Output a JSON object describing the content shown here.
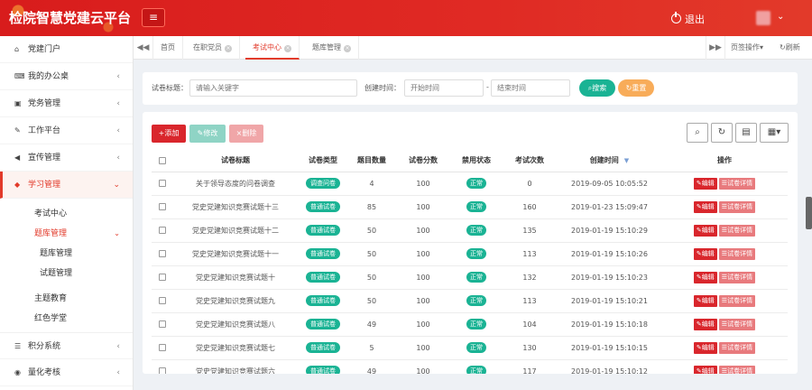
{
  "app": {
    "title": "检院智慧党建云平台",
    "menu_icon": "bars-icon",
    "logout": "退出"
  },
  "sidebar": {
    "items": [
      {
        "label": "党建门户",
        "icon": "home-icon",
        "arrow": ""
      },
      {
        "label": "我的办公桌",
        "icon": "keyboard-icon",
        "arrow": "‹"
      },
      {
        "label": "党务管理",
        "icon": "id-card-icon",
        "arrow": "‹"
      },
      {
        "label": "工作平台",
        "icon": "edit-icon",
        "arrow": "‹"
      },
      {
        "label": "宣传管理",
        "icon": "bullhorn-icon",
        "arrow": "‹"
      },
      {
        "label": "学习管理",
        "icon": "graduation-cap-icon",
        "arrow": "⌄"
      }
    ],
    "sub": {
      "exam_center": "考试中心",
      "question_bank_mgmt": "题库管理",
      "question_bank_mgmt_arrow": "⌄",
      "question_bank": "题库管理",
      "question_mgmt": "试题管理",
      "theme_edu": "主题教育",
      "red_study": "红色学堂"
    },
    "bottom": [
      {
        "label": "积分系统",
        "icon": "list-icon",
        "arrow": "‹"
      },
      {
        "label": "量化考核",
        "icon": "database-icon",
        "arrow": "‹"
      }
    ]
  },
  "tabs": {
    "prev": "◀◀",
    "items": [
      {
        "label": "首页"
      },
      {
        "label": "在职党员",
        "close": "×"
      },
      {
        "label": "考试中心",
        "close": "×"
      },
      {
        "label": "题库管理",
        "close": "×"
      }
    ],
    "next": "▶▶",
    "page_ops": "页签操作",
    "page_ops_caret": "▾",
    "refresh": "刷新"
  },
  "search": {
    "title_label": "试卷标题：",
    "title_placeholder": "请输入关键字",
    "time_label": "创建时间：",
    "start_placeholder": "开始时间",
    "sep": "-",
    "end_placeholder": "结束时间",
    "search_btn": "搜索",
    "reset_btn": "重置"
  },
  "toolbar": {
    "add": "添加",
    "edit": "修改",
    "delete": "删除"
  },
  "tools": {
    "search_icon": "search-icon",
    "refresh_icon": "refresh-icon",
    "export_icon": "export-icon",
    "columns_icon": "grid-icon",
    "columns_caret": "▾"
  },
  "table": {
    "headers": [
      "试卷标题",
      "试卷类型",
      "题目数量",
      "试卷分数",
      "禁用状态",
      "考试次数",
      "创建时间",
      "操作"
    ],
    "sort_icon": "▼",
    "edit_label": "编辑",
    "detail_label": "试卷详情",
    "rows": [
      {
        "title": "关于领导态度的问卷调查",
        "type": "调查问卷",
        "count": "4",
        "score": "100",
        "status": "正常",
        "times": "0",
        "created": "2019-09-05 10:05:52"
      },
      {
        "title": "党史党建知识竞赛试题十三",
        "type": "普通试卷",
        "count": "85",
        "score": "100",
        "status": "正常",
        "times": "160",
        "created": "2019-01-23 15:09:47"
      },
      {
        "title": "党史党建知识竞赛试题十二",
        "type": "普通试卷",
        "count": "50",
        "score": "100",
        "status": "正常",
        "times": "135",
        "created": "2019-01-19 15:10:29"
      },
      {
        "title": "党史党建知识竞赛试题十一",
        "type": "普通试卷",
        "count": "50",
        "score": "100",
        "status": "正常",
        "times": "113",
        "created": "2019-01-19 15:10:26"
      },
      {
        "title": "党史党建知识竞赛试题十",
        "type": "普通试卷",
        "count": "50",
        "score": "100",
        "status": "正常",
        "times": "132",
        "created": "2019-01-19 15:10:23"
      },
      {
        "title": "党史党建知识竞赛试题九",
        "type": "普通试卷",
        "count": "50",
        "score": "100",
        "status": "正常",
        "times": "113",
        "created": "2019-01-19 15:10:21"
      },
      {
        "title": "党史党建知识竞赛试题八",
        "type": "普通试卷",
        "count": "49",
        "score": "100",
        "status": "正常",
        "times": "104",
        "created": "2019-01-19 15:10:18"
      },
      {
        "title": "党史党建知识竞赛试题七",
        "type": "普通试卷",
        "count": "5",
        "score": "100",
        "status": "正常",
        "times": "130",
        "created": "2019-01-19 15:10:15"
      },
      {
        "title": "党史党建知识竞赛试题六",
        "type": "普通试卷",
        "count": "49",
        "score": "100",
        "status": "正常",
        "times": "117",
        "created": "2019-01-19 15:10:12"
      }
    ]
  },
  "colors": {
    "primary": "#e23a2a",
    "green": "#1ab394",
    "orange": "#f8ac59"
  }
}
